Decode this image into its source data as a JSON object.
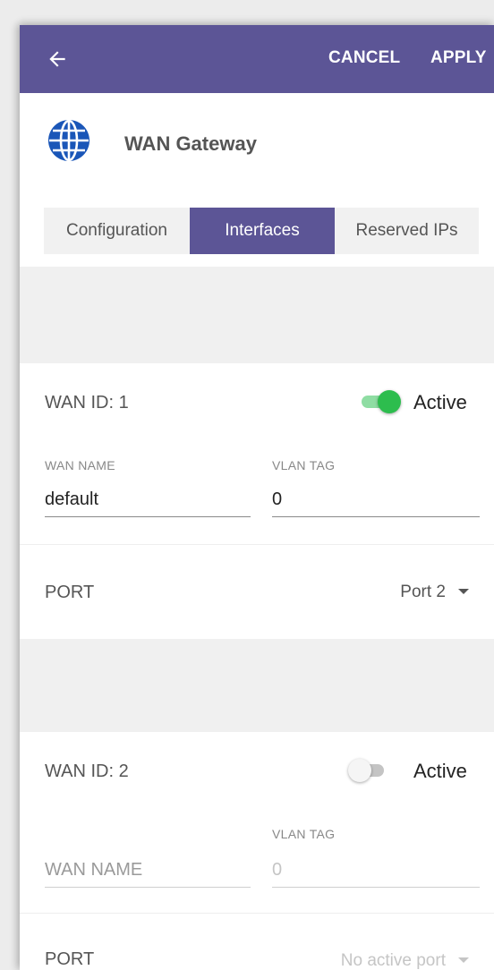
{
  "appbar": {
    "back_icon": "arrow-left-icon",
    "cancel_label": "CANCEL",
    "apply_label": "APPLY",
    "color": "#5c5596"
  },
  "header": {
    "icon": "globe-icon",
    "title": "WAN Gateway"
  },
  "tabs": [
    {
      "label": "Configuration",
      "selected": false
    },
    {
      "label": "Interfaces",
      "selected": true
    },
    {
      "label": "Reserved IPs",
      "selected": false
    }
  ],
  "wans": [
    {
      "id_label": "WAN ID: 1",
      "active": true,
      "active_label": "Active",
      "name_label": "WAN NAME",
      "name_value": "default",
      "vlan_label": "VLAN TAG",
      "vlan_value": "0",
      "port_label": "PORT",
      "port_value": "Port 2"
    },
    {
      "id_label": "WAN ID: 2",
      "active": false,
      "active_label": "Active",
      "name_placeholder": "WAN NAME",
      "vlan_label": "VLAN TAG",
      "vlan_placeholder": "0",
      "port_label": "PORT",
      "port_value": "No active port"
    }
  ],
  "colors": {
    "accent": "#5c5596",
    "toggle_on": "#2dbd4e",
    "toggle_off": "#f5f5f5"
  }
}
